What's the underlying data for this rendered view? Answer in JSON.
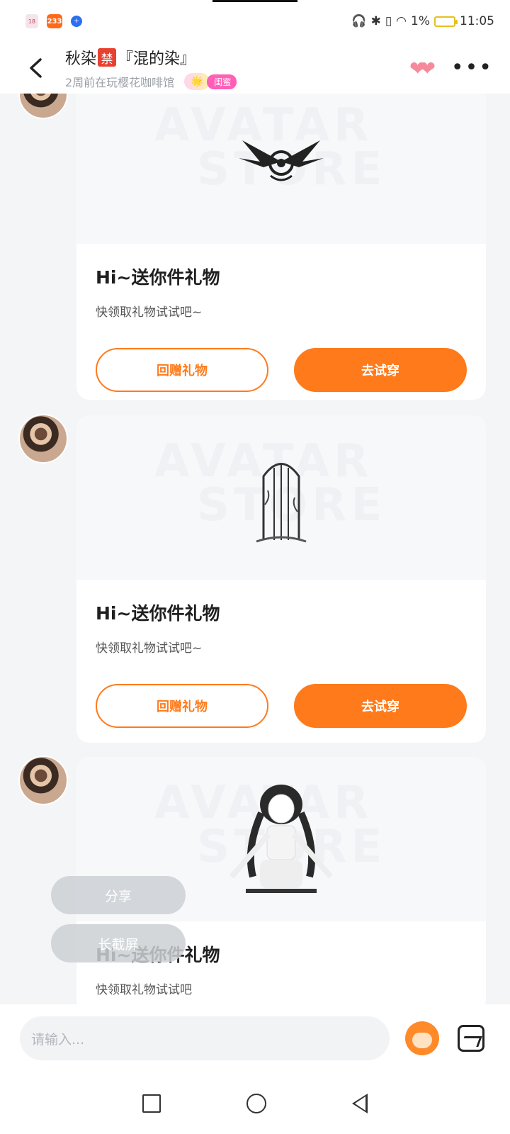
{
  "status_bar": {
    "app_icons": [
      "18",
      "233",
      "+"
    ],
    "battery": "1%",
    "time": "11:05"
  },
  "header": {
    "name": "秋染",
    "ban_badge": "禁",
    "group": "『混的染』",
    "activity": "2周前在玩樱花咖啡馆",
    "relation_tag": "闺蜜",
    "relation_icon": "🌟"
  },
  "messages": [
    {
      "title": "Hi~送你件礼物",
      "desc": "快领取礼物试试吧~",
      "return_label": "回赠礼物",
      "try_label": "去试穿",
      "item_icon": "winged-emblem-icon"
    },
    {
      "title": "Hi~送你件礼物",
      "desc": "快领取礼物试试吧~",
      "return_label": "回赠礼物",
      "try_label": "去试穿",
      "item_icon": "ornate-gate-icon"
    },
    {
      "title": "Hi~送你件礼物",
      "desc": "快领取礼物试试吧",
      "item_icon": "avatar-character-icon"
    }
  ],
  "watermark": {
    "line1": "AVATAR",
    "line2": "STORE"
  },
  "float_menu": {
    "share": "分享",
    "long_screenshot": "长截屏"
  },
  "input": {
    "placeholder": "请输入..."
  },
  "colors": {
    "accent": "#ff7a1a",
    "ban": "#e8412f",
    "bff": "#ff5fb7"
  }
}
